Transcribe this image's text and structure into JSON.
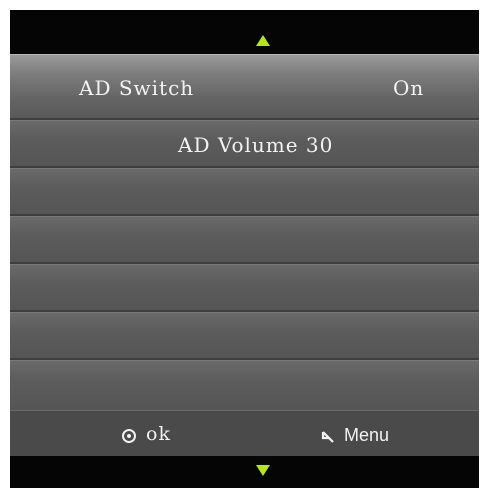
{
  "menu": {
    "rows": [
      {
        "label": "AD Switch",
        "value": "On"
      },
      {
        "label": "AD Volume 30",
        "value": ""
      }
    ]
  },
  "footer": {
    "ok_label": "ok",
    "menu_label": "Menu"
  },
  "icons": {
    "scroll_up": "scroll-up-arrow-icon",
    "scroll_down": "scroll-down-arrow-icon",
    "ok": "ok-circle-icon",
    "back": "return-arrow-icon"
  },
  "colors": {
    "accent": "#b5e61d",
    "panel": "#5a5a5a",
    "bar": "#050505"
  }
}
